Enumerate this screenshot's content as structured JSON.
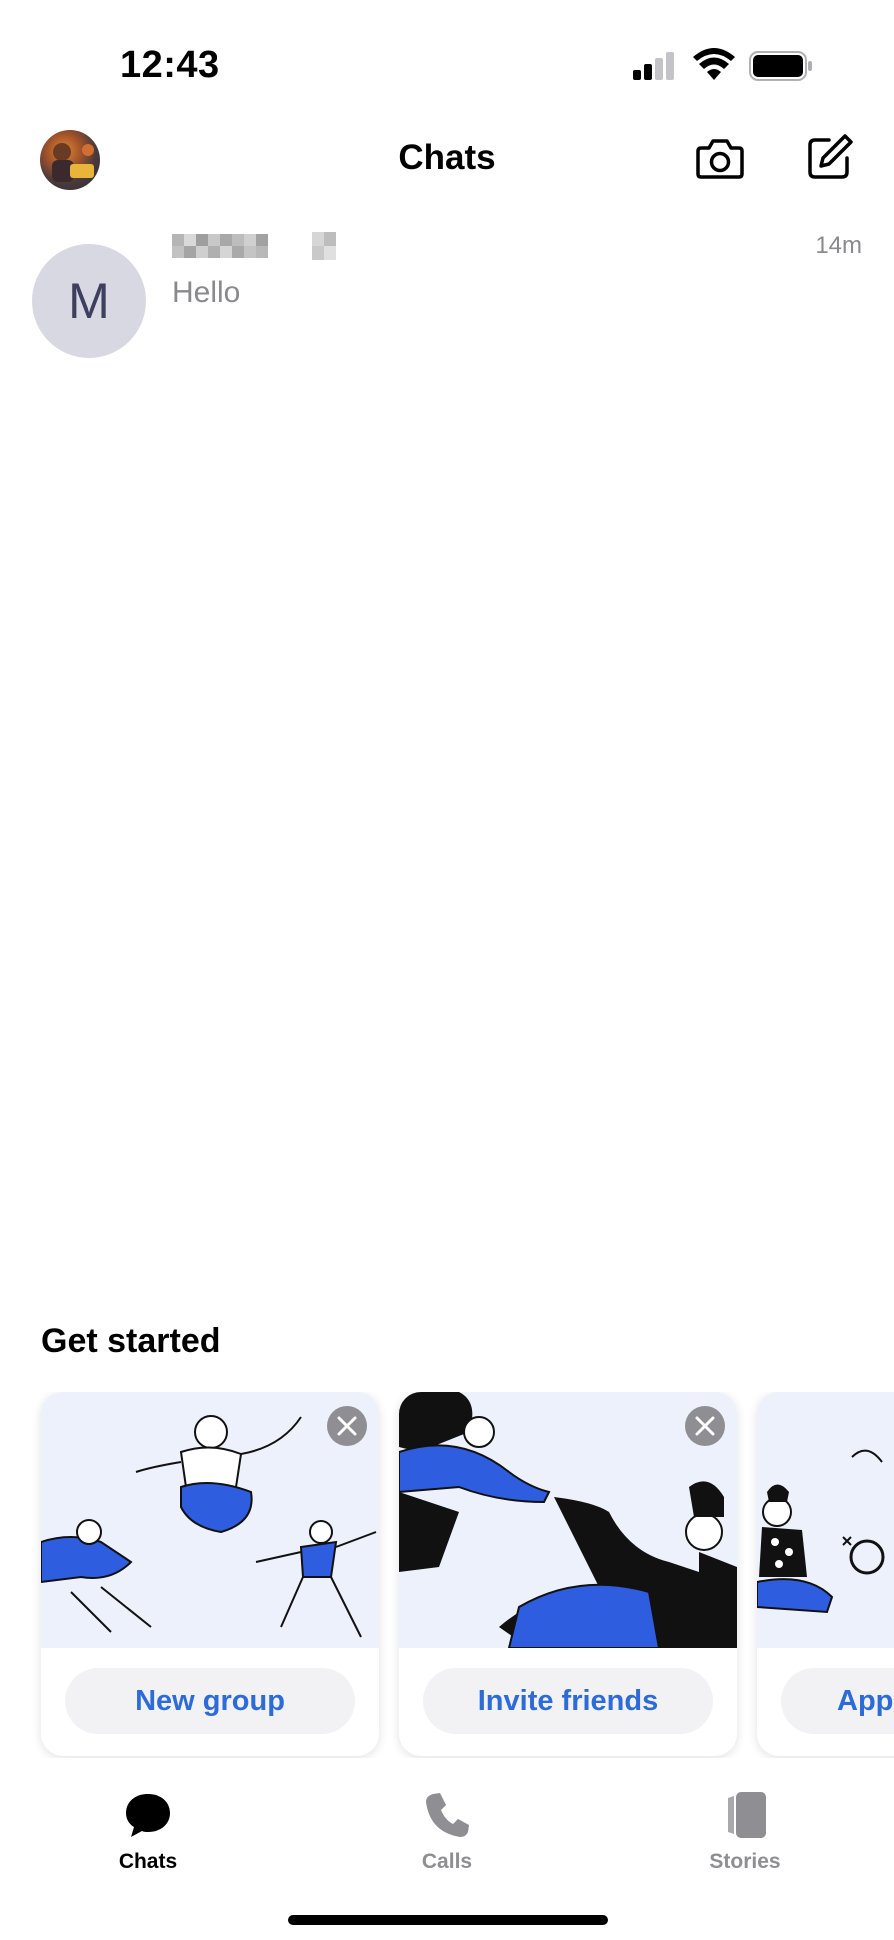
{
  "status_bar": {
    "time": "12:43"
  },
  "header": {
    "title": "Chats"
  },
  "chats": [
    {
      "avatar_letter": "M",
      "preview": "Hello",
      "time": "14m"
    }
  ],
  "get_started": {
    "title": "Get started",
    "cards": [
      {
        "action": "New group"
      },
      {
        "action": "Invite friends"
      },
      {
        "action": "App"
      }
    ]
  },
  "tabs": [
    {
      "label": "Chats",
      "icon": "chat-bubble-icon",
      "active": true
    },
    {
      "label": "Calls",
      "icon": "phone-icon",
      "active": false
    },
    {
      "label": "Stories",
      "icon": "stories-icon",
      "active": false
    }
  ],
  "colors": {
    "accent": "#2c6bd8",
    "illustration_blue": "#2f5de0",
    "muted_text": "#8a8a8e"
  }
}
